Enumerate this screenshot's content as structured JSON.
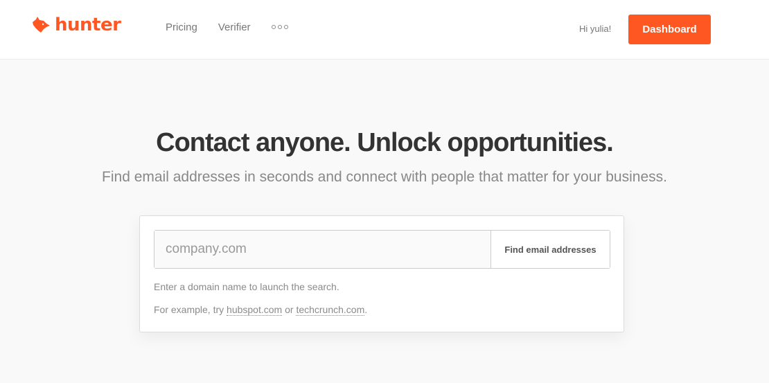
{
  "brand": {
    "name": "hunter",
    "icon": "fox-head-icon",
    "color": "#ff5722"
  },
  "nav": {
    "links": [
      {
        "label": "Pricing"
      },
      {
        "label": "Verifier"
      }
    ],
    "more_icon": "more-dots-icon",
    "greeting": "Hi yulia!",
    "dashboard_label": "Dashboard"
  },
  "hero": {
    "title": "Contact anyone. Unlock opportunities.",
    "subtitle": "Find email addresses in seconds and connect with people that matter for your business."
  },
  "search": {
    "placeholder": "company.com",
    "value": "",
    "button_label": "Find email addresses",
    "help_text": "Enter a domain name to launch the search.",
    "example_prefix": "For example, try ",
    "example_1": "hubspot.com",
    "example_joiner": " or ",
    "example_2": "techcrunch.com",
    "example_suffix": "."
  }
}
